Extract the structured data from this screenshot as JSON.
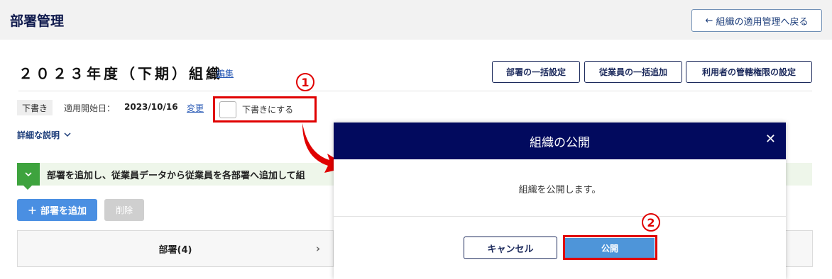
{
  "header": {
    "title": "部署管理",
    "back_label": "組織の適用管理へ戻る"
  },
  "org": {
    "title": "２０２３年度（下期）組織",
    "edit_label": "編集",
    "status_badge": "下書き",
    "start_label": "適用開始日：",
    "start_date": "2023/10/16",
    "change_label": "変更",
    "draft_checkbox_label": "下書きにする",
    "details_label": "詳細な説明"
  },
  "toolbar": {
    "bulk_dept_label": "部署の一括設定",
    "bulk_emp_label": "従業員の一括追加",
    "perm_label": "利用者の管轄権限の設定"
  },
  "banner": {
    "text": "部署を追加し、従業員データから従業員を各部署へ追加して組"
  },
  "actions": {
    "add_dept_label": "部署を追加",
    "delete_label": "削除"
  },
  "dept_column": {
    "header": "部署(4)"
  },
  "modal": {
    "title": "組織の公開",
    "message": "組織を公開します。",
    "cancel_label": "キャンセル",
    "publish_label": "公開"
  },
  "annotations": {
    "step1": "1",
    "step2": "2",
    "highlight_color": "#e00000"
  },
  "colors": {
    "modal_header": "#020a5e",
    "primary": "#4a8fe2",
    "banner_icon": "#3ea33e"
  }
}
